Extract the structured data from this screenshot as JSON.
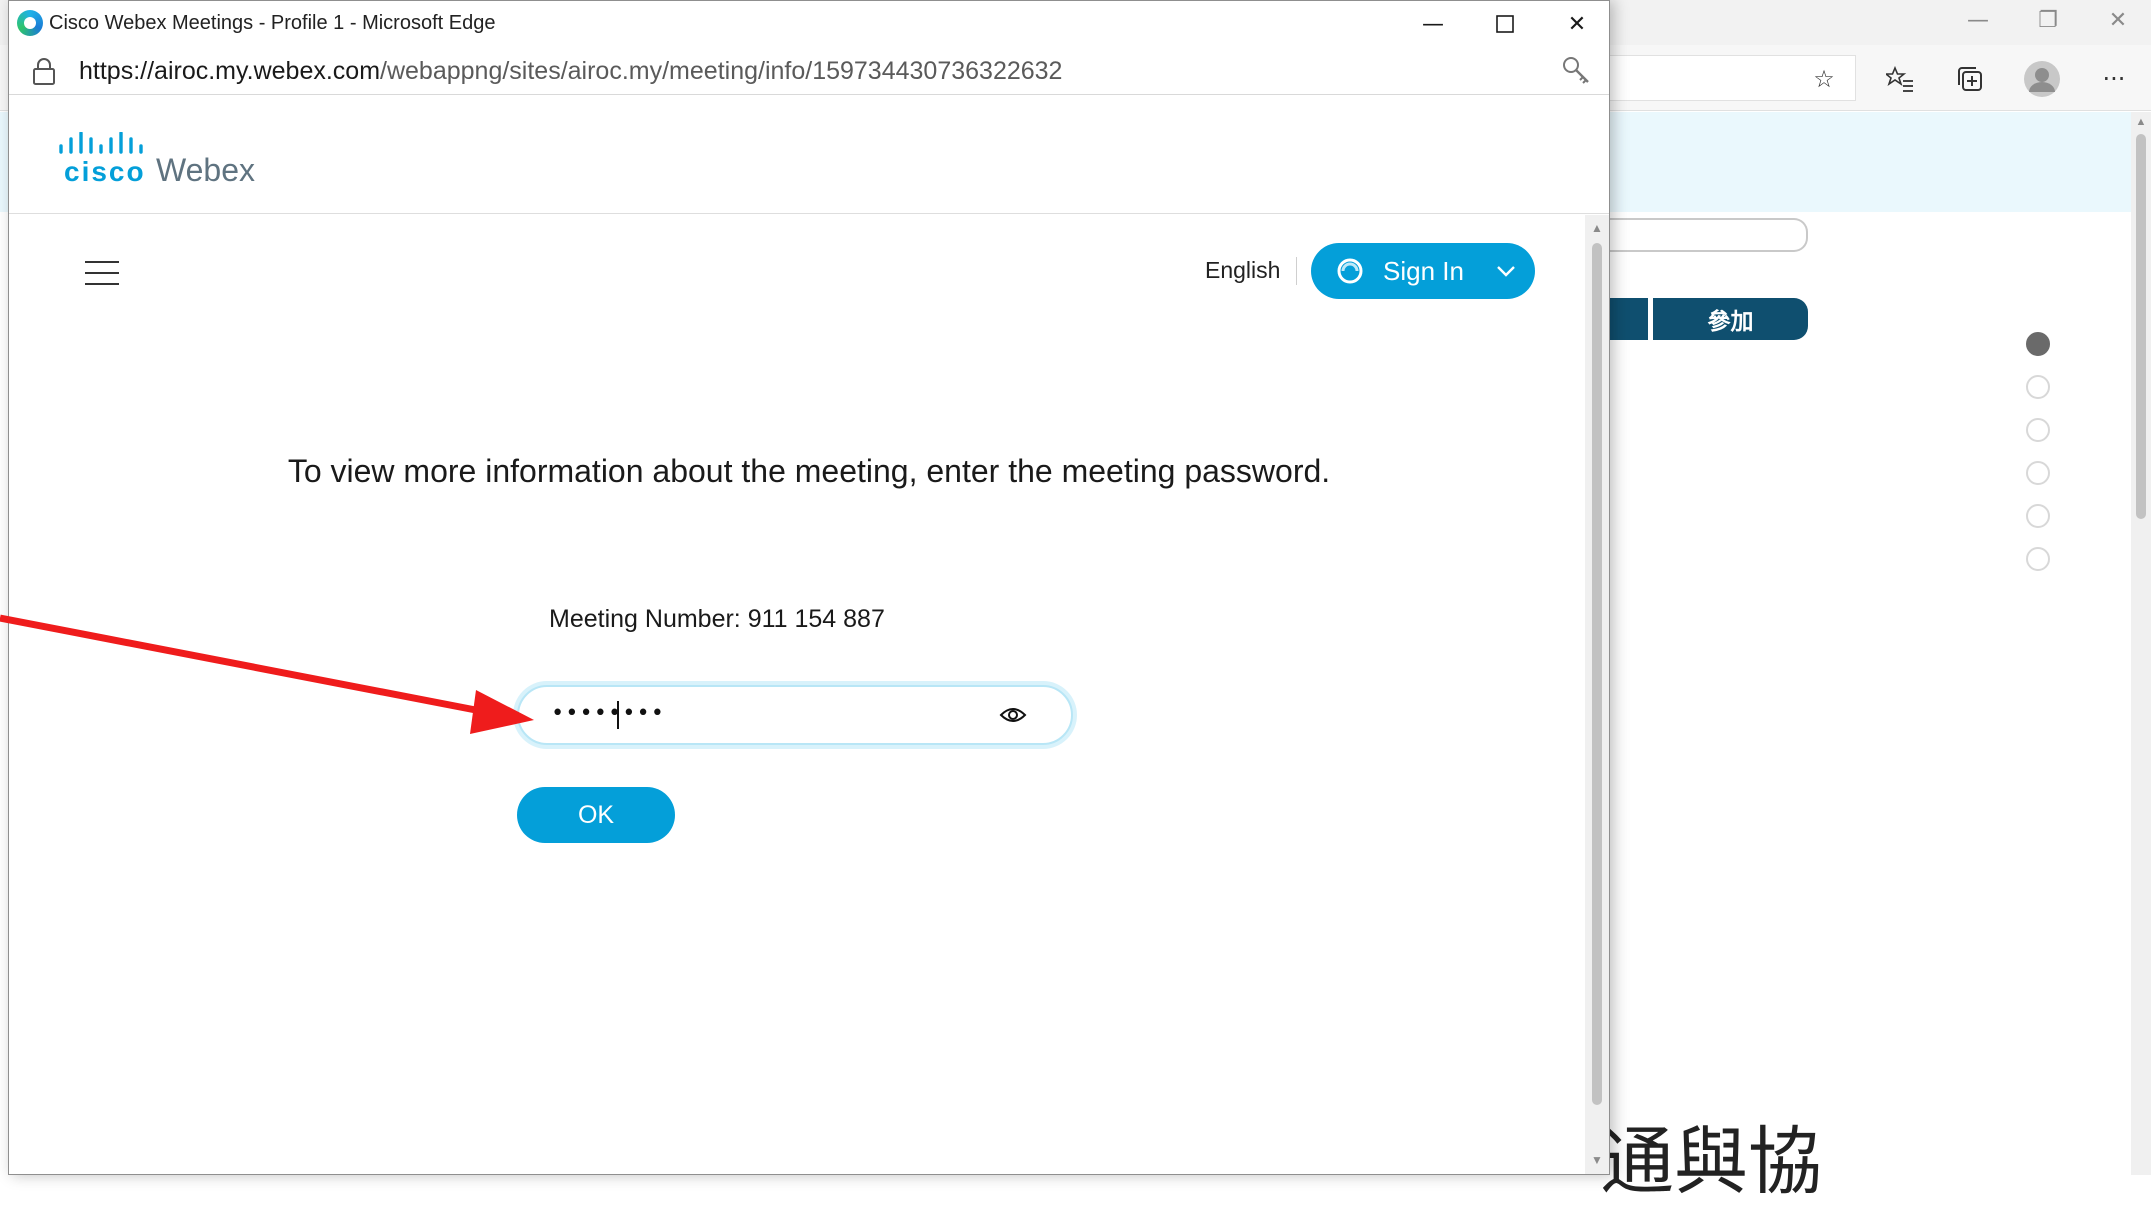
{
  "background_window": {
    "join_button_label": "參加",
    "partial_heading": "通與協",
    "pagination_dots": [
      true,
      false,
      false,
      false,
      false,
      false
    ]
  },
  "popup": {
    "window_title": "Cisco Webex Meetings - Profile 1 - Microsoft Edge",
    "url_host_part": "https://airoc.my.webex.com",
    "url_path_part": "/webappng/sites/airoc.my/meeting/info/159734430736322632"
  },
  "page": {
    "logo_cisco": "cisco",
    "logo_webex": "Webex",
    "language_label": "English",
    "signin_label": "Sign In",
    "info_message": "To view more information about the meeting, enter the meeting password.",
    "meeting_number_text": "Meeting Number: 911 154 887",
    "password_masked": "••••••••",
    "ok_label": "OK"
  },
  "colors": {
    "webex_blue": "#049fd9",
    "join_button_bg": "#0f4f6f",
    "annotation_red": "#ef1c1c"
  }
}
